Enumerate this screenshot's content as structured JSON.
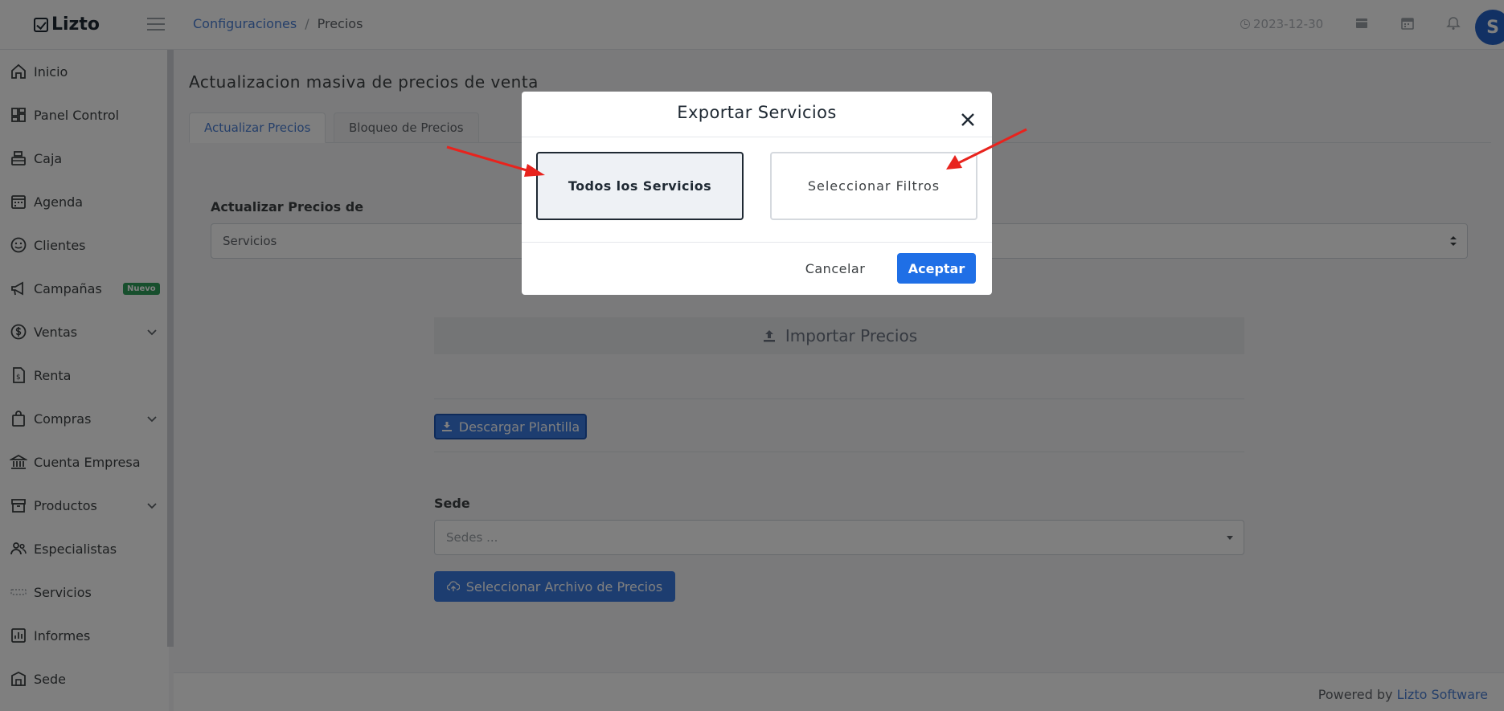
{
  "app": {
    "logo_text": "Lizto"
  },
  "breadcrumb": {
    "parent": "Configuraciones",
    "separator": "/",
    "current": "Precios"
  },
  "topbar": {
    "date": "2023-12-30",
    "avatar_initial": "S"
  },
  "sidebar": {
    "items": [
      {
        "label": "Inicio",
        "icon": "home-icon"
      },
      {
        "label": "Panel Control",
        "icon": "dashboard-icon"
      },
      {
        "label": "Caja",
        "icon": "cash-register-icon"
      },
      {
        "label": "Agenda",
        "icon": "calendar-icon"
      },
      {
        "label": "Clientes",
        "icon": "smiley-icon"
      },
      {
        "label": "Campañas",
        "icon": "megaphone-icon",
        "badge": "Nuevo"
      },
      {
        "label": "Ventas",
        "icon": "dollar-icon",
        "expandable": true
      },
      {
        "label": "Renta",
        "icon": "invoice-icon"
      },
      {
        "label": "Compras",
        "icon": "shopping-bag-icon",
        "expandable": true
      },
      {
        "label": "Cuenta Empresa",
        "icon": "bank-icon"
      },
      {
        "label": "Productos",
        "icon": "archive-box-icon",
        "expandable": true
      },
      {
        "label": "Especialistas",
        "icon": "users-icon"
      },
      {
        "label": "Servicios",
        "icon": "services-icon"
      },
      {
        "label": "Informes",
        "icon": "report-chart-icon"
      },
      {
        "label": "Sede",
        "icon": "building-icon"
      }
    ]
  },
  "main": {
    "title": "Actualizacion masiva de precios de venta",
    "tabs": [
      {
        "label": "Actualizar Precios",
        "active": true
      },
      {
        "label": "Bloqueo de Precios",
        "active": false
      }
    ],
    "update_from_label": "Actualizar Precios de",
    "update_from_value": "Servicios",
    "import_label": "Importar Precios",
    "download_label": "Descargar Plantilla",
    "sede_label": "Sede",
    "sede_placeholder": "Sedes ...",
    "select_file_label": "Seleccionar Archivo de Precios"
  },
  "footer": {
    "text": "Powered by",
    "link": "Lizto Software"
  },
  "modal": {
    "title": "Exportar Servicios",
    "option_all": "Todos los Servicios",
    "option_filters": "Seleccionar Filtros",
    "selected_option": "Todos los Servicios",
    "cancel_label": "Cancelar",
    "accept_label": "Aceptar"
  },
  "colors": {
    "accent": "#1f6fe6",
    "link": "#4a7fd4",
    "badge": "#2e9e5b",
    "annotation_arrow": "#e8231d"
  }
}
